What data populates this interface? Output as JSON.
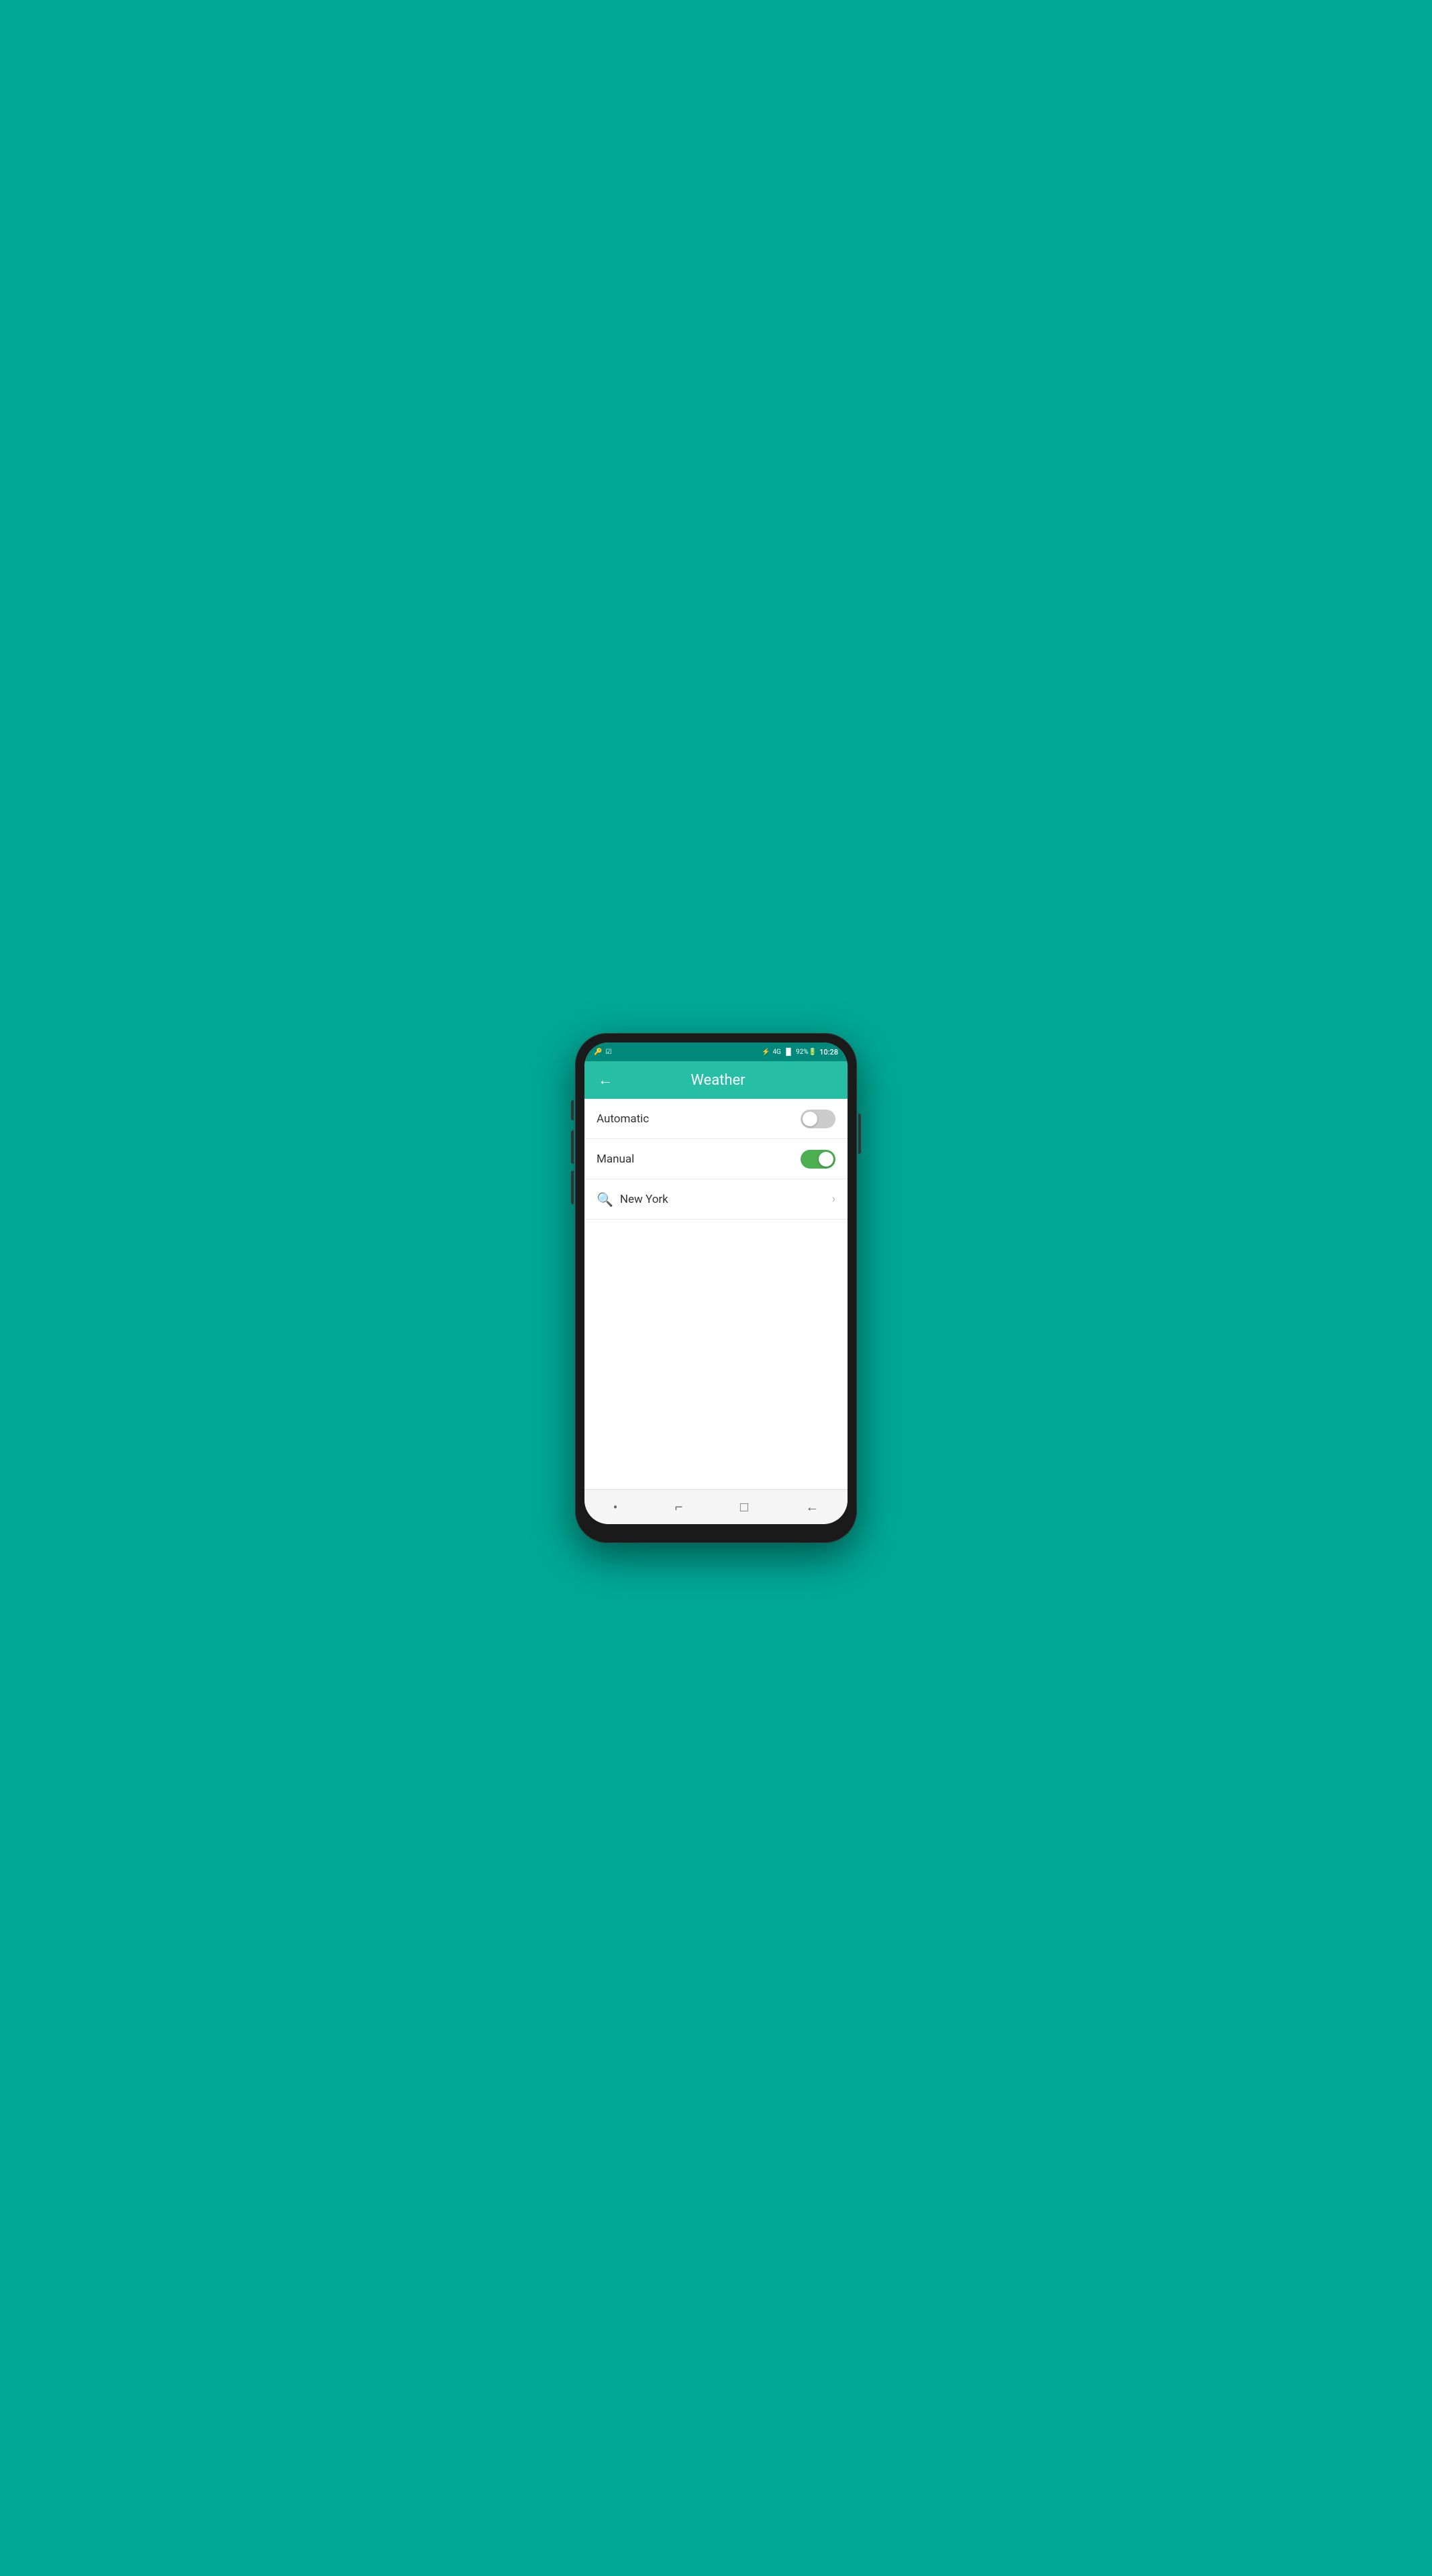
{
  "status_bar": {
    "time": "10:28",
    "battery": "92%",
    "signal_icons": "4G"
  },
  "top_bar": {
    "title": "Weather",
    "back_label": "←"
  },
  "settings": {
    "automatic_label": "Automatic",
    "automatic_enabled": false,
    "manual_label": "Manual",
    "manual_enabled": true,
    "location_label": "New York"
  },
  "nav_bar": {
    "home_icon": "•",
    "recent_icon": "⌐",
    "square_icon": "□",
    "back_icon": "←"
  },
  "colors": {
    "teal_bg": "#00A896",
    "teal_bar": "#26BFA6",
    "teal_dark": "#00897B",
    "toggle_on": "#4CAF50",
    "toggle_off": "#CCCCCC"
  }
}
